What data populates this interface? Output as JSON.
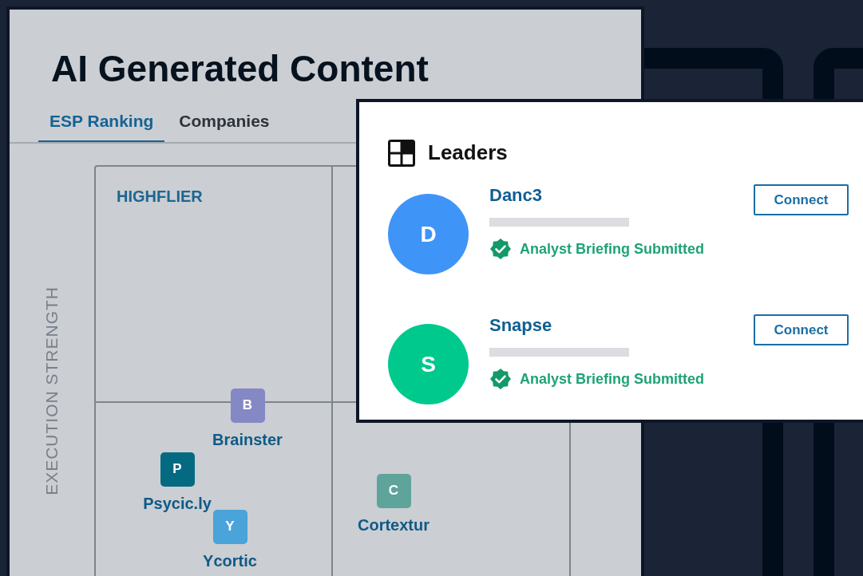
{
  "page": {
    "title": "AI Generated Content"
  },
  "tabs": [
    {
      "label": "ESP Ranking",
      "selected": true
    },
    {
      "label": "Companies",
      "selected": false
    }
  ],
  "matrix": {
    "axis_label": "EXECUTION STRENGTH",
    "quadrant_label": "HIGHFLIER",
    "companies": [
      {
        "initial": "B",
        "name": "Brainster",
        "color": "#8488c4"
      },
      {
        "initial": "P",
        "name": "Psycic.ly",
        "color": "#036a82"
      },
      {
        "initial": "Y",
        "name": "Ycortic",
        "color": "#4aa3d9"
      },
      {
        "initial": "C",
        "name": "Cortextur",
        "color": "#5fa49b"
      }
    ]
  },
  "leaders": {
    "title": "Leaders",
    "items": [
      {
        "initial": "D",
        "name": "Danc3",
        "color": "#3f94f7",
        "status": "Analyst Briefing Submitted",
        "button": "Connect"
      },
      {
        "initial": "S",
        "name": "Snapse",
        "color": "#00c98d",
        "status": "Analyst Briefing Submitted",
        "button": "Connect"
      }
    ]
  }
}
